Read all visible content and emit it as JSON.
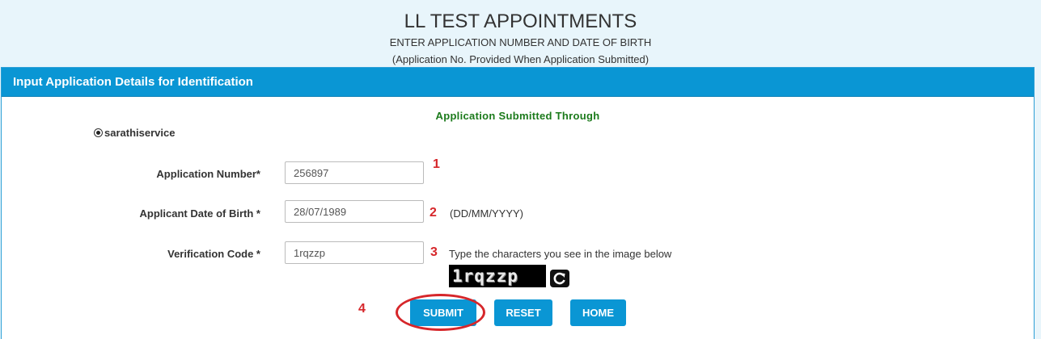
{
  "header": {
    "title": "LL TEST APPOINTMENTS",
    "subtitle": "ENTER APPLICATION NUMBER AND DATE OF BIRTH",
    "note": "(Application No. Provided When Application Submitted)"
  },
  "panel": {
    "heading": "Input Application Details for Identification",
    "submitted_through": "Application Submitted Through",
    "radio_option": "sarathiservice"
  },
  "form": {
    "application_number": {
      "label": "Application Number*",
      "value": "256897",
      "marker": "1"
    },
    "dob": {
      "label": "Applicant Date of Birth *",
      "value": "28/07/1989",
      "hint": "(DD/MM/YYYY)",
      "marker": "2"
    },
    "verification": {
      "label": "Verification Code *",
      "value": "1rqzzp",
      "hint": "Type the characters you see in the image below",
      "marker": "3"
    },
    "captcha_text": "1rqzzp"
  },
  "buttons": {
    "marker": "4",
    "submit": "SUBMIT",
    "reset": "RESET",
    "home": "HOME"
  },
  "colors": {
    "accent": "#0a96d4",
    "annotation": "#d6262a",
    "success_text": "#1b7a1b"
  },
  "icons": {
    "radio": "radio-selected-icon",
    "refresh": "refresh-icon"
  }
}
